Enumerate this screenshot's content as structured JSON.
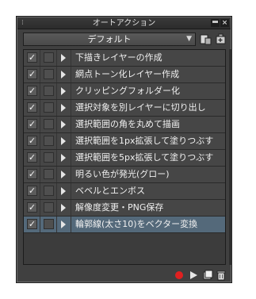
{
  "window": {
    "title": "オートアクション"
  },
  "set": {
    "selected": "デフォルト"
  },
  "actions": [
    {
      "label": "下描きレイヤーの作成",
      "checked": true
    },
    {
      "label": "網点トーン化レイヤー作成",
      "checked": true
    },
    {
      "label": "クリッピングフォルダー化",
      "checked": true
    },
    {
      "label": "選択対象を別レイヤーに切り出し",
      "checked": true
    },
    {
      "label": "選択範囲の角を丸めて描画",
      "checked": true
    },
    {
      "label": "選択範囲を1px拡張して塗りつぶす",
      "checked": true
    },
    {
      "label": "選択範囲を5px拡張して塗りつぶす",
      "checked": true
    },
    {
      "label": "明るい色が発光(グロー)",
      "checked": true
    },
    {
      "label": "ベベルとエンボス",
      "checked": true
    },
    {
      "label": "解像度変更・PNG保存",
      "checked": true
    },
    {
      "label": "輪郭線(太さ10)をベクター変換",
      "checked": true,
      "selected": true
    }
  ],
  "icons": {
    "record": "record-icon",
    "play": "play-icon",
    "new": "new-action-icon",
    "delete": "trash-icon",
    "set_menu": "set-menu-icon",
    "set_new": "new-set-icon"
  },
  "colors": {
    "record": "#e02020",
    "selected_row": "#54697a"
  }
}
